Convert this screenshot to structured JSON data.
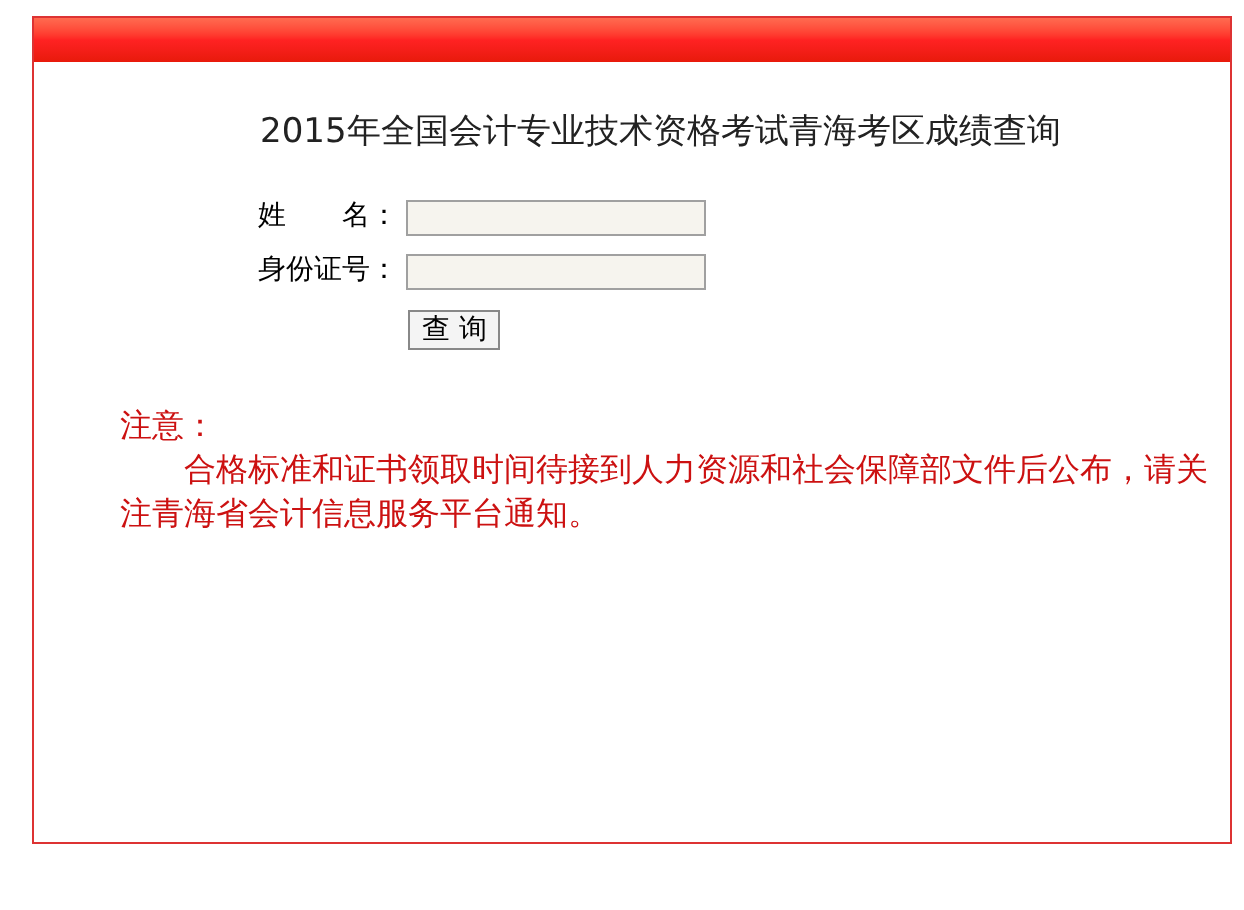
{
  "title": "2015年全国会计专业技术资格考试青海考区成绩查询",
  "form": {
    "fields": [
      {
        "label": "姓　　名："
      },
      {
        "label": "身份证号："
      }
    ],
    "button": "查 询"
  },
  "notice": {
    "heading": "注意：",
    "text": "合格标准和证书领取时间待接到人力资源和社会保障部文件后公布，请关注青海省会计信息服务平台通知。"
  }
}
